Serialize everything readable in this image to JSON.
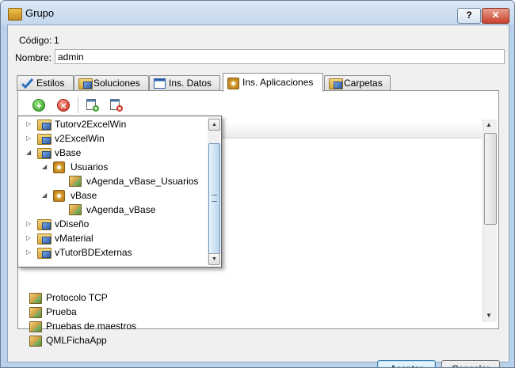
{
  "window": {
    "title": "Grupo",
    "help_label": "?",
    "close_label": "✕"
  },
  "fields": {
    "codigo_label": "Código:",
    "codigo_value": "1",
    "nombre_label": "Nombre:",
    "nombre_value": "admin"
  },
  "tabs": [
    {
      "label": "Estilos",
      "icon": "checkmark-icon"
    },
    {
      "label": "Soluciones",
      "icon": "solutions-icon"
    },
    {
      "label": "Ins. Datos",
      "icon": "window-icon"
    },
    {
      "label": "Ins. Aplicaciones",
      "icon": "module-icon",
      "active": true
    },
    {
      "label": "Carpetas",
      "icon": "folder-icon"
    }
  ],
  "toolbar": {
    "add_label": "+",
    "remove_label": "×"
  },
  "list_items": [
    {
      "label": "Protocolo TCP"
    },
    {
      "label": "Prueba"
    },
    {
      "label": "Pruebas de maestros"
    },
    {
      "label": "QMLFichaApp"
    }
  ],
  "tree": [
    {
      "label": "Tutorv2ExcelWin",
      "level": 0,
      "kind": "folder",
      "expander": "▷"
    },
    {
      "label": "v2ExcelWin",
      "level": 0,
      "kind": "folder",
      "expander": "▷"
    },
    {
      "label": "vBase",
      "level": 0,
      "kind": "folder",
      "expander": "◢"
    },
    {
      "label": "Usuarios",
      "level": 1,
      "kind": "module",
      "expander": "◢"
    },
    {
      "label": "vAgenda_vBase_Usuarios",
      "level": 2,
      "kind": "package",
      "expander": ""
    },
    {
      "label": "vBase",
      "level": 1,
      "kind": "module",
      "expander": "◢"
    },
    {
      "label": "vAgenda_vBase",
      "level": 2,
      "kind": "package",
      "expander": ""
    },
    {
      "label": "vDiseño",
      "level": 0,
      "kind": "folder",
      "expander": "▷"
    },
    {
      "label": "vMaterial",
      "level": 0,
      "kind": "folder",
      "expander": "▷"
    },
    {
      "label": "vTutorBDExternas",
      "level": 0,
      "kind": "folder",
      "expander": "▷"
    }
  ],
  "buttons": {
    "accept": "Aceptar",
    "cancel": "Cancelar"
  },
  "colors": {
    "title_bg": "#c3d7ed",
    "close": "#c8412a",
    "accent": "#3c7fb1"
  }
}
